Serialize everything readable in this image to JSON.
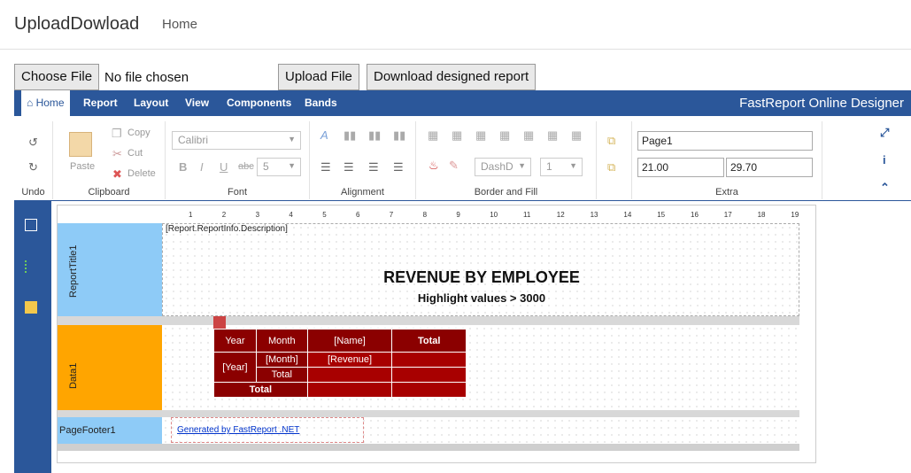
{
  "navbar": {
    "brand": "UploadDowload",
    "home": "Home"
  },
  "upload": {
    "choose_file": "Choose File",
    "no_file": "No file chosen",
    "upload_file": "Upload File",
    "download": "Download designed report"
  },
  "designer": {
    "title": "FastReport Online Designer",
    "tabs": [
      "Home",
      "Report",
      "Layout",
      "View",
      "Components",
      "Bands"
    ],
    "ribbon": {
      "undo": "Undo",
      "clipboard": {
        "label": "Clipboard",
        "paste": "Paste",
        "copy": "Copy",
        "cut": "Cut",
        "delete": "Delete"
      },
      "font": {
        "label": "Font",
        "family": "Calibri",
        "size": "5"
      },
      "alignment": {
        "label": "Alignment"
      },
      "border": {
        "label": "Border and Fill",
        "dash": "DashD",
        "width": "1"
      },
      "extra": {
        "label": "Extra",
        "page": "Page1",
        "width": "21.00",
        "height": "29.70"
      }
    },
    "ruler": [
      "1",
      "2",
      "3",
      "4",
      "5",
      "6",
      "7",
      "8",
      "9",
      "10",
      "11",
      "12",
      "13",
      "14",
      "15",
      "16",
      "17",
      "18",
      "19"
    ],
    "bands": {
      "report_title": "ReportTitle1",
      "data": "Data1",
      "page_footer": "PageFooter1"
    },
    "report": {
      "description": "[Report.ReportInfo.Description]",
      "title": "REVENUE BY EMPLOYEE",
      "subtitle": "Highlight values > 3000",
      "table": {
        "h_year": "Year",
        "h_month": "Month",
        "h_name": "[Name]",
        "h_total": "Total",
        "year": "[Year]",
        "month": "[Month]",
        "revenue": "[Revenue]",
        "month_total": "Total",
        "grand_total": "Total"
      },
      "footer_link": "Generated by FastReport .NET"
    },
    "colors": {
      "primary": "#2b579a",
      "report_title_band": "#8ecbf7",
      "data_band": "#ffa500",
      "table_header": "#8b0000",
      "table_body": "#a80000"
    }
  }
}
